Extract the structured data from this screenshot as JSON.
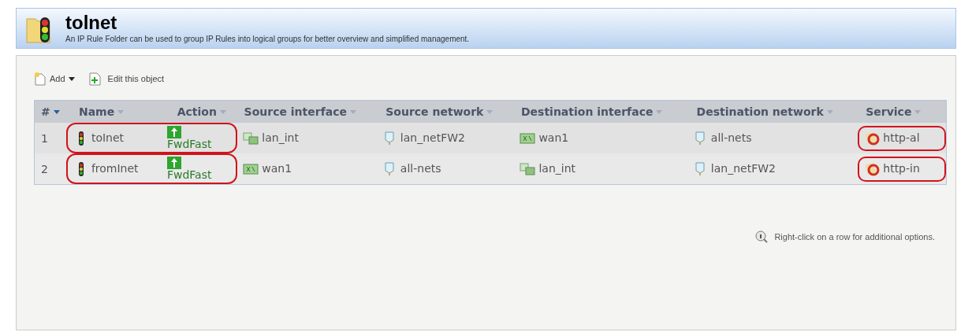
{
  "header": {
    "title": "tolnet",
    "description": "An IP Rule Folder can be used to group IP Rules into logical groups for better overview and simplified management."
  },
  "toolbar": [
    {
      "kind": "add",
      "label": "Add"
    },
    {
      "kind": "edit",
      "label": "Edit this object"
    }
  ],
  "table": {
    "columns": [
      "#",
      "Name",
      "Action",
      "Source interface",
      "Source network",
      "Destination interface",
      "Destination network",
      "Service"
    ],
    "rows": [
      {
        "index": "1",
        "name": "toInet",
        "action": "FwdFast",
        "source_interface": {
          "name": "lan_int",
          "kind": "lan"
        },
        "source_network": "lan_netFW2",
        "destination_interface": {
          "name": "wan1",
          "kind": "wan"
        },
        "destination_network": "all-nets",
        "service": "http-al",
        "highlighted": true
      },
      {
        "index": "2",
        "name": "fromInet",
        "action": "FwdFast",
        "source_interface": {
          "name": "wan1",
          "kind": "wan"
        },
        "source_network": "all-nets",
        "destination_interface": {
          "name": "lan_int",
          "kind": "lan"
        },
        "destination_network": "lan_netFW2",
        "service": "http-in",
        "highlighted": true
      }
    ]
  },
  "hint": "Right-click on a row for additional options."
}
